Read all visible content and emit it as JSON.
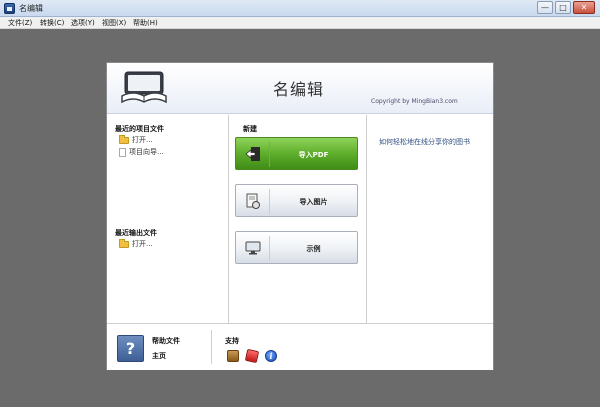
{
  "window": {
    "title": "名编辑",
    "min_glyph": "—",
    "max_glyph": "□",
    "close_glyph": "✕"
  },
  "menu": [
    "文件(Z)",
    "转换(C)",
    "选项(Y)",
    "视图(X)",
    "帮助(H)"
  ],
  "header": {
    "app_name": "名编辑",
    "copyright": "Copyright by MingBian3.com"
  },
  "recent_projects": {
    "title": "最近的项目文件",
    "items": [
      {
        "label": "打开...",
        "icon": "folder-icon"
      },
      {
        "label": "项目向导...",
        "icon": "document-icon"
      }
    ]
  },
  "recent_outputs": {
    "title": "最近输出文件",
    "items": [
      {
        "label": "打开...",
        "icon": "folder-icon"
      }
    ]
  },
  "new_section": {
    "title": "新建",
    "buttons": [
      {
        "label": "导入PDF",
        "icon": "import-pdf-icon",
        "color": "#5fae2c"
      },
      {
        "label": "导入图片",
        "icon": "import-image-icon"
      },
      {
        "label": "示例",
        "icon": "monitor-icon"
      }
    ]
  },
  "tip": "如何轻松地在线分享你的图书",
  "footer": {
    "help_title": "帮助文件",
    "help_link": "主页",
    "help_icon_glyph": "?",
    "support_title": "支持",
    "support_icons": [
      "package-icon",
      "dice-icon",
      "info-icon"
    ],
    "info_glyph": "i"
  },
  "colors": {
    "accent_green": "#5fae2c",
    "background": "#6b6b6b",
    "tip_text": "#2f4f7f"
  }
}
